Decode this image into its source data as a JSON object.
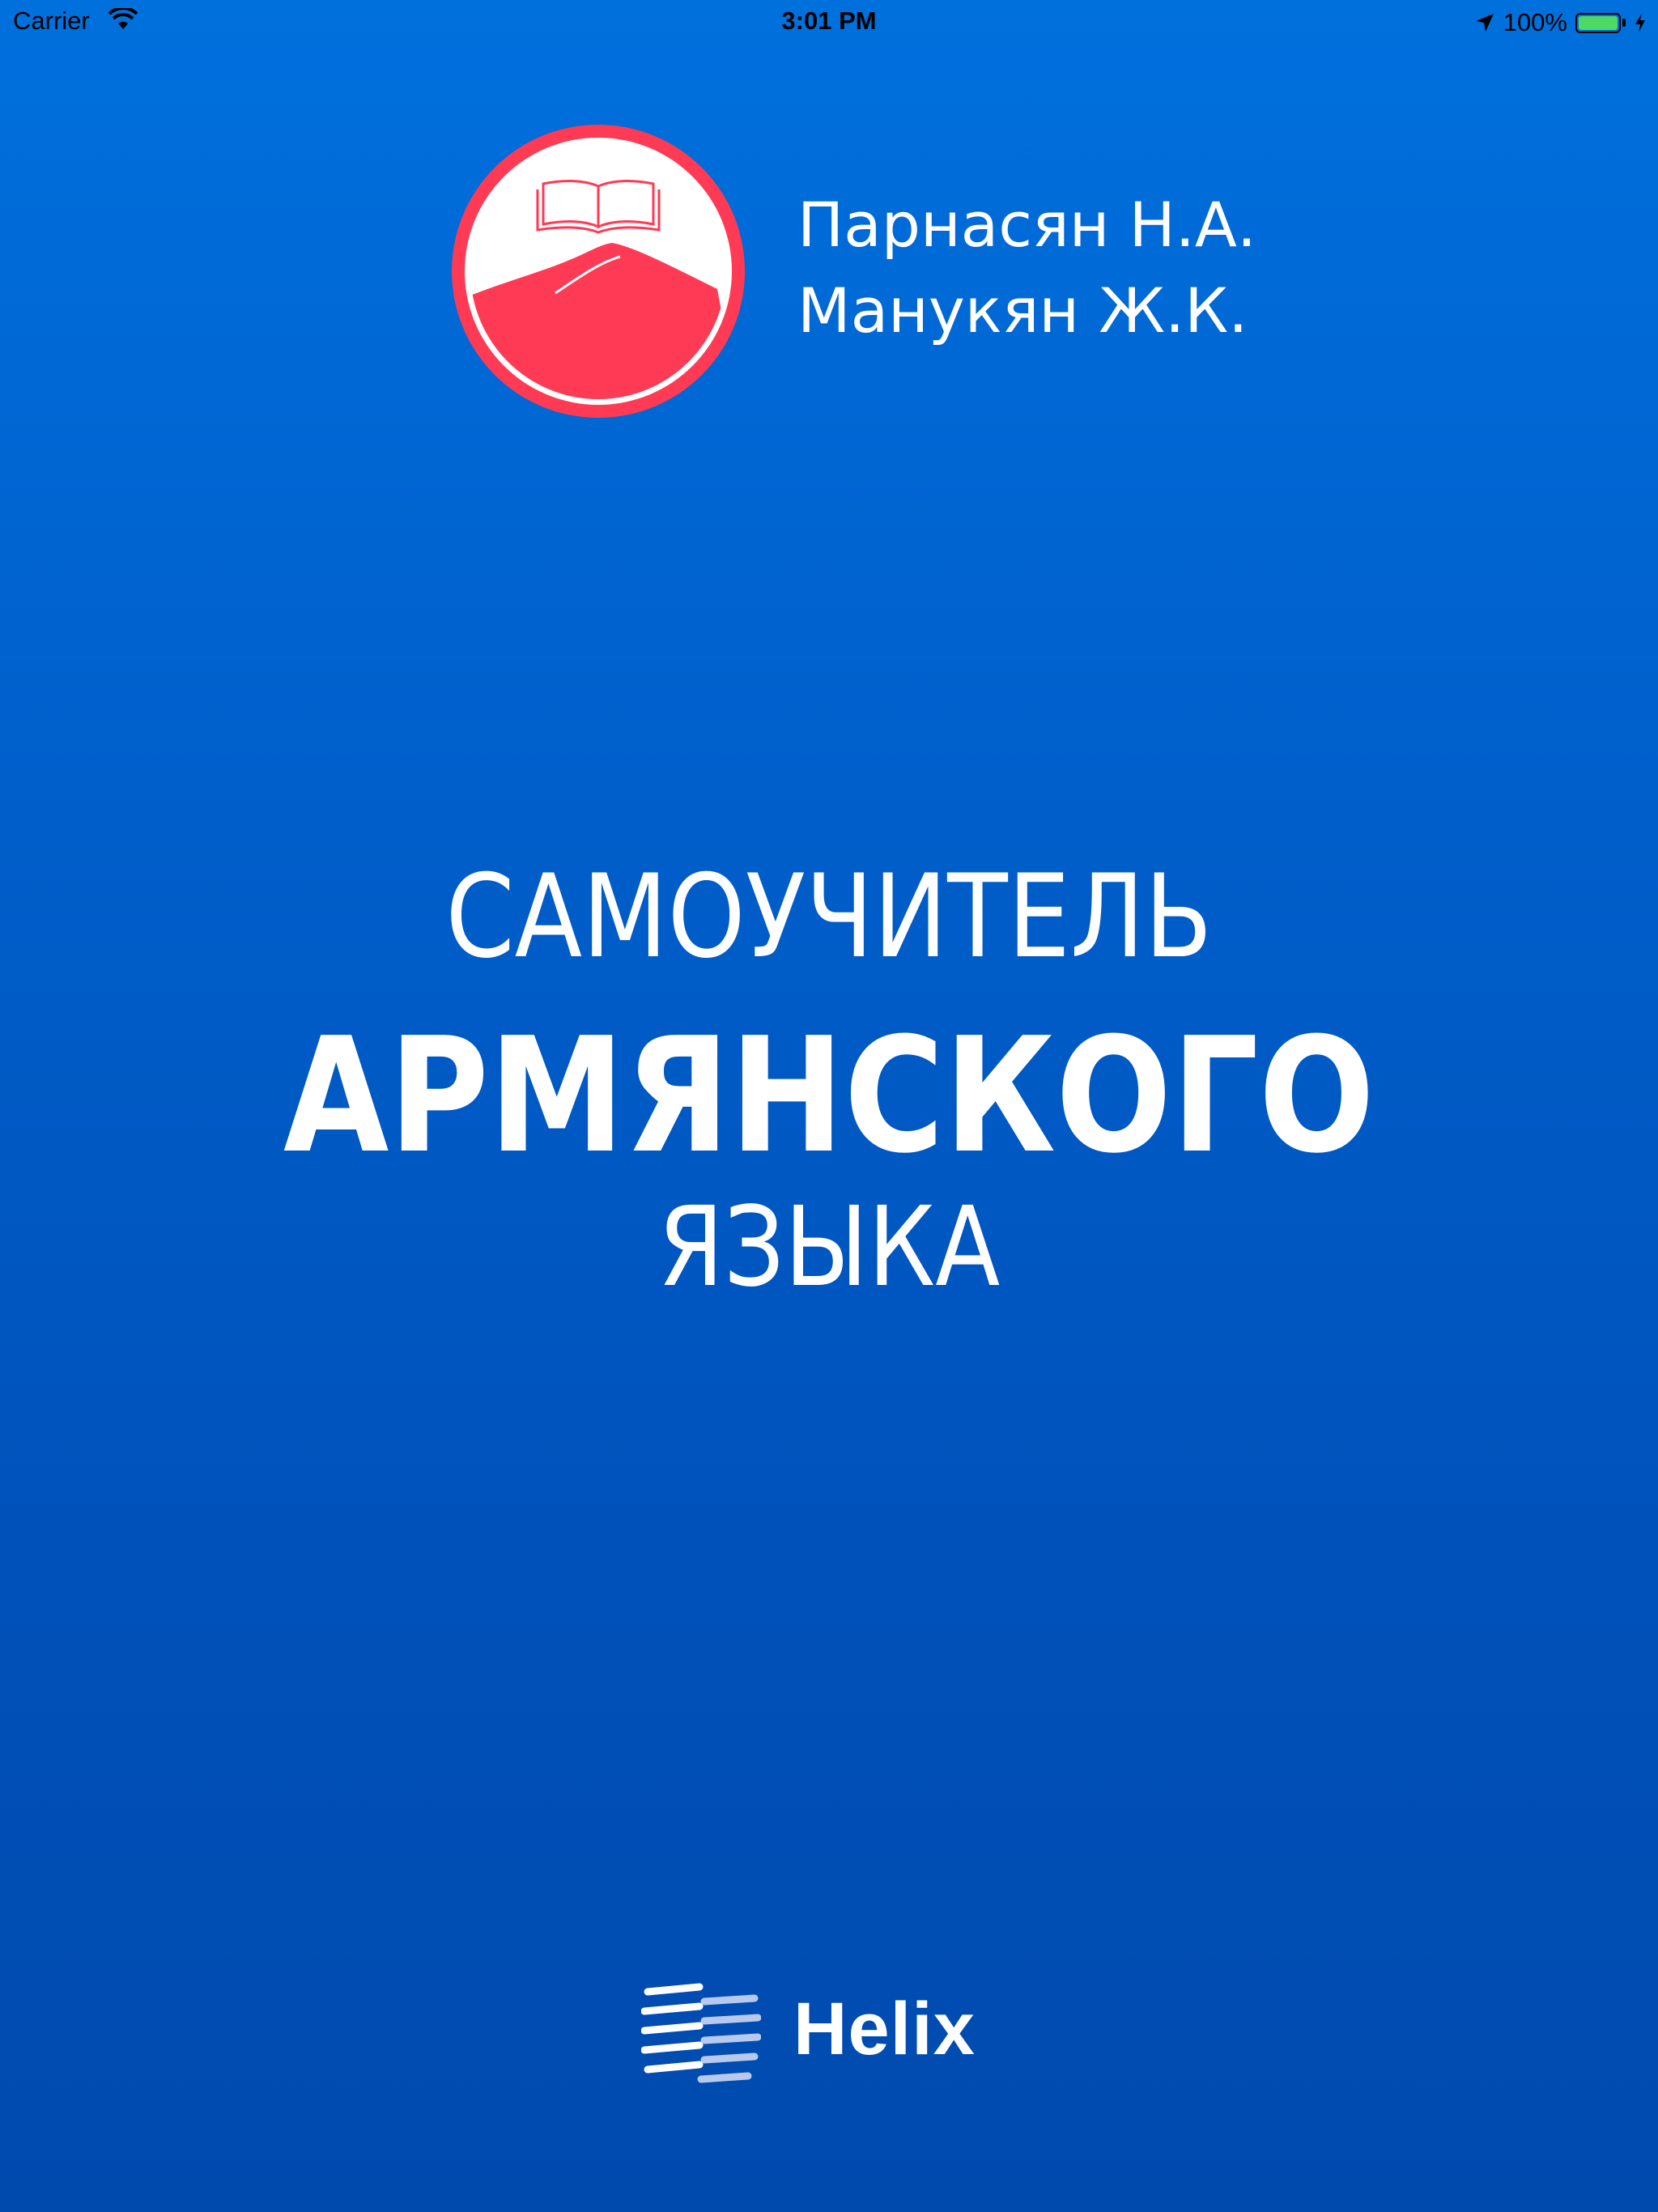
{
  "status_bar": {
    "carrier": "Carrier",
    "time": "3:01 PM",
    "battery_percent": "100%",
    "battery_level": 1.0,
    "icons": [
      "wifi-icon",
      "location-arrow-icon",
      "battery-icon",
      "charging-bolt-icon"
    ]
  },
  "cover": {
    "logo": "book-mountain-logo",
    "authors": [
      "Парнасян Н.А.",
      "Манукян Ж.К."
    ],
    "title_line1": "САМОУЧИТЕЛЬ",
    "title_line2": "АРМЯНСКОГО",
    "title_line3": "ЯЗЫКА"
  },
  "publisher": {
    "name": "Helix",
    "logo": "helix-stripes-logo"
  },
  "colors": {
    "background_top": "#0070dd",
    "background_bottom": "#004aae",
    "logo_red": "#ff3a54",
    "text": "#ffffff",
    "battery_green": "#4cd964"
  }
}
